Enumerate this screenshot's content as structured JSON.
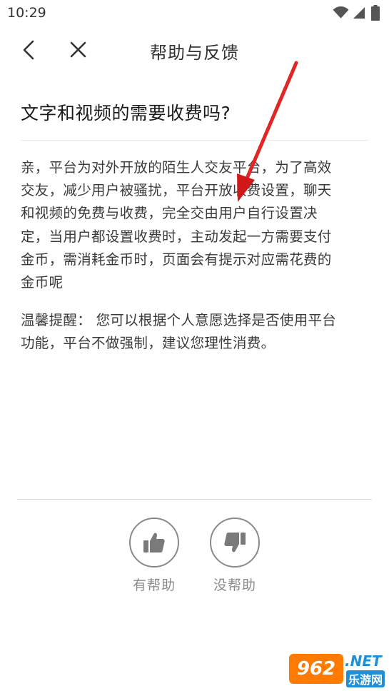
{
  "status_bar": {
    "time": "10:29",
    "icons": [
      "wifi-icon",
      "signal-icon",
      "battery-icon"
    ]
  },
  "header": {
    "title": "帮助与反馈",
    "back_icon": "chevron-left-icon",
    "close_icon": "close-icon"
  },
  "question": {
    "title": "文字和视频的需要收费吗?"
  },
  "answer": {
    "lines": [
      "亲，平台为对外开放的陌生人交友平台，为了高效",
      "交友，减少用户被骚扰，平台开放收费设置，聊天",
      "和视频的免费与收费，完全交由用户自行设置决",
      "定，当用户都设置收费时，主动发起一方需要支付",
      "金币，需消耗金币时，页面会有提示对应需花费的",
      "金币呢"
    ],
    "reminder_lines": [
      "温馨提醒： 您可以根据个人意愿选择是否使用平台",
      "功能，平台不做强制，建议您理性消费。"
    ]
  },
  "feedback": {
    "helpful_label": "有帮助",
    "not_helpful_label": "没帮助",
    "helpful_icon": "thumbs-up-icon",
    "not_helpful_icon": "thumbs-down-icon"
  },
  "annotation": {
    "icon": "red-arrow-icon",
    "color": "#e02020"
  },
  "watermark": {
    "badge": "962",
    "net": ".NET",
    "sub": "乐游网",
    "colors": {
      "orange": "#ff7a00",
      "blue": "#1f8fd8"
    }
  },
  "colors": {
    "text": "#3a3a3a",
    "title": "#1a1a1a",
    "muted": "#8a8a8a",
    "divider": "#d8d8d8"
  }
}
